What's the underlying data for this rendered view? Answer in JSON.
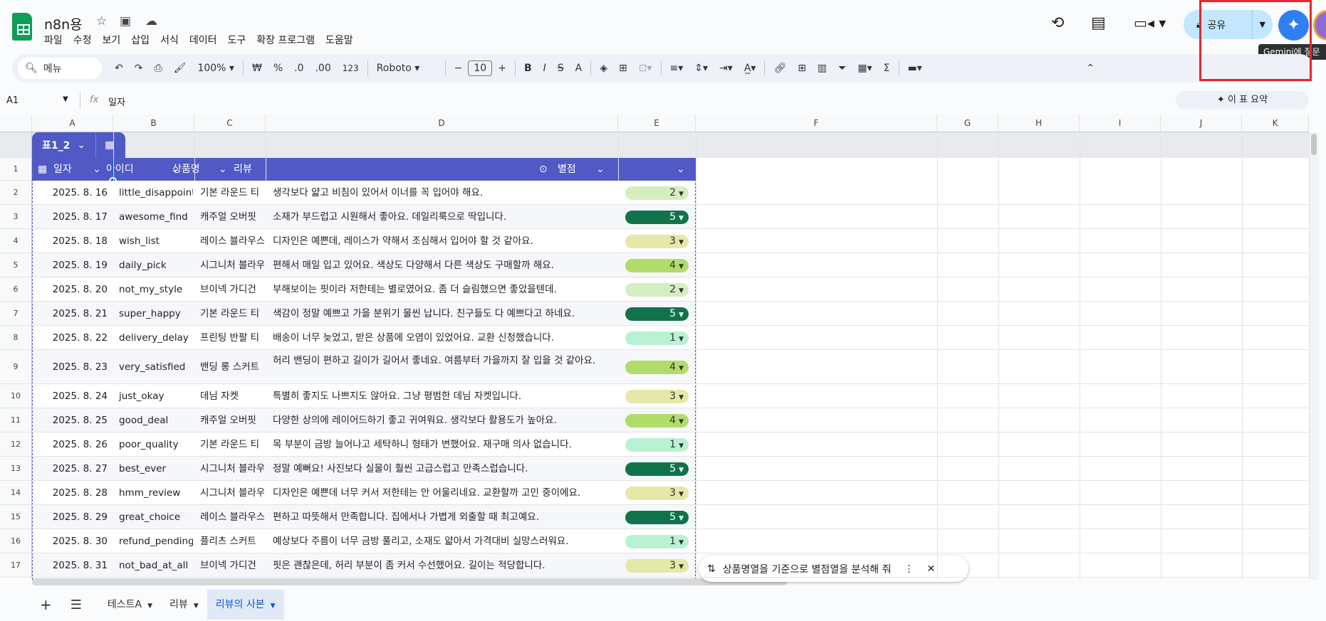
{
  "app": {
    "title": "n8n용",
    "menu": [
      "파일",
      "수정",
      "보기",
      "삽입",
      "서식",
      "데이터",
      "도구",
      "확장 프로그램",
      "도움말"
    ]
  },
  "header": {
    "share_label": "공유",
    "tooltip": "Gemini에 질문"
  },
  "toolbar": {
    "search_label": "메뉴",
    "zoom": "100%",
    "currency": "₩",
    "percent": "%",
    "dec_decrease": ".0",
    "dec_increase": ".00",
    "format": "123",
    "font": "Roboto",
    "font_size": "10",
    "bold": "B",
    "italic": "I",
    "text_color": "A"
  },
  "formula": {
    "cell_ref": "A1",
    "fx": "fx",
    "value": "일자",
    "summary_label": "이 표 요약"
  },
  "columns": [
    "A",
    "B",
    "C",
    "D",
    "E",
    "F",
    "G",
    "H",
    "I",
    "J",
    "K"
  ],
  "table": {
    "name": "표1_2",
    "headers": [
      "일자",
      "아이디",
      "상품명",
      "리뷰",
      "별점"
    ],
    "rows": [
      [
        "2025. 8. 16",
        "little_disappoint",
        "기본 라운드 티",
        "생각보다 얇고 비침이 있어서 이너를 꼭 입어야 해요.",
        "2"
      ],
      [
        "2025. 8. 17",
        "awesome_find",
        "캐주얼 오버핏",
        "소재가 부드럽고 시원해서 좋아요. 데일리룩으로 딱입니다.",
        "5"
      ],
      [
        "2025. 8. 18",
        "wish_list",
        "레이스 블라우스",
        "디자인은 예쁜데, 레이스가 약해서 조심해서 입어야 할 것 같아요.",
        "3"
      ],
      [
        "2025. 8. 19",
        "daily_pick",
        "시그니처 블라우스",
        "편해서 매일 입고 있어요. 색상도 다양해서 다른 색상도 구매할까 해요.",
        "4"
      ],
      [
        "2025. 8. 20",
        "not_my_style",
        "브이넥 가디건",
        "부해보이는 핏이라 저한테는 별로였어요. 좀 더 슬림했으면 좋았을텐데.",
        "2"
      ],
      [
        "2025. 8. 21",
        "super_happy",
        "기본 라운드 티",
        "색감이 정말 예쁘고 가을 분위기 물씬 납니다. 친구들도 다 예쁘다고 하네요.",
        "5"
      ],
      [
        "2025. 8. 22",
        "delivery_delay",
        "프린팅 반팔 티",
        "배송이 너무 늦었고, 받은 상품에 오염이 있었어요. 교환 신청했습니다.",
        "1"
      ],
      [
        "2025. 8. 23",
        "very_satisfied",
        "밴딩 롱 스커트",
        "허리 밴딩이 편하고 길이가 길어서 좋네요. 여름부터 가을까지 잘 입을 것 같아요.",
        "4"
      ],
      [
        "2025. 8. 24",
        "just_okay",
        "데님 자켓",
        "특별히 좋지도 나쁘지도 않아요. 그냥 평범한 데님 자켓입니다.",
        "3"
      ],
      [
        "2025. 8. 25",
        "good_deal",
        "캐주얼 오버핏",
        "다양한 상의에 레이어드하기 좋고 귀여워요. 생각보다 활용도가 높아요.",
        "4"
      ],
      [
        "2025. 8. 26",
        "poor_quality",
        "기본 라운드 티",
        "목 부분이 금방 늘어나고 세탁하니 형태가 변했어요. 재구매 의사 없습니다.",
        "1"
      ],
      [
        "2025. 8. 27",
        "best_ever",
        "시그니처 블라우스",
        "정말 예뻐요! 사진보다 실물이 훨씬 고급스럽고 만족스럽습니다.",
        "5"
      ],
      [
        "2025. 8. 28",
        "hmm_review",
        "시그니처 블라우스",
        "디자인은 예쁜데 너무 커서 저한테는 안 어울리네요. 교환할까 고민 중이에요.",
        "3"
      ],
      [
        "2025. 8. 29",
        "great_choice",
        "레이스 블라우스",
        "편하고 따뜻해서 만족합니다. 집에서나 가볍게 외출할 때 최고예요.",
        "5"
      ],
      [
        "2025. 8. 30",
        "refund_pending",
        "플리츠 스커트",
        "예상보다 주름이 너무 금방 풀리고, 소재도 얇아서 가격대비 실망스러워요.",
        "1"
      ],
      [
        "2025. 8. 31",
        "not_bad_at_all",
        "브이넥 가디건",
        "핏은 괜찮은데, 허리 부분이 좀 커서 수선했어요. 길이는 적당합니다.",
        "3"
      ]
    ],
    "rating_colors": {
      "1": "#b8f2d2",
      "2": "#d5eec0",
      "3": "#e4e8a8",
      "4": "#b2dc6a",
      "5": "#11734b"
    }
  },
  "gemini_chip": {
    "text": "상품명열을 기준으로 별점열을 분석해 줘"
  },
  "sheets": {
    "tabs": [
      "테스트A",
      "리뷰",
      "리뷰의 사본"
    ],
    "active": "리뷰의 사본"
  },
  "colors": {
    "accent": "#0b57d0",
    "table_header": "#5059c4",
    "share_bg": "#c2e7ff"
  }
}
